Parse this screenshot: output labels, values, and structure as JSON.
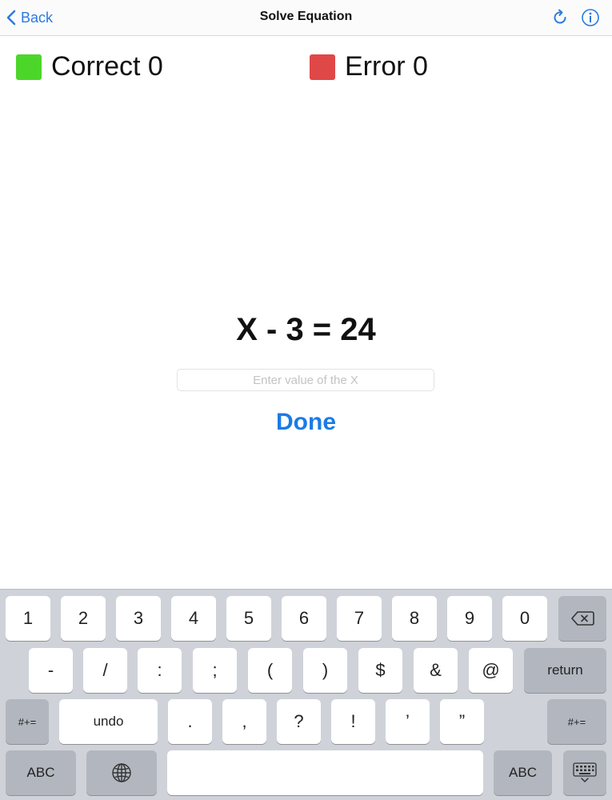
{
  "navbar": {
    "back_label": "Back",
    "title": "Solve Equation",
    "icons": {
      "back": "chevron-left-icon",
      "refresh": "refresh-icon",
      "info": "info-icon"
    }
  },
  "scores": {
    "correct": {
      "label": "Correct 0",
      "color": "#4cd629"
    },
    "error": {
      "label": "Error 0",
      "color": "#e04747"
    }
  },
  "equation": {
    "text": "X - 3 = 24",
    "input_placeholder": "Enter value of the X",
    "input_value": "",
    "done_label": "Done"
  },
  "keyboard": {
    "row1": [
      "1",
      "2",
      "3",
      "4",
      "5",
      "6",
      "7",
      "8",
      "9",
      "0"
    ],
    "row2": [
      "-",
      "/",
      ":",
      ";",
      "(",
      ")",
      "$",
      "&",
      "@"
    ],
    "row3": [
      ".",
      ",",
      "?",
      "!",
      "’",
      "”"
    ],
    "return_label": "return",
    "shift_label": "#+=",
    "undo_label": "undo",
    "abc_label": "ABC",
    "icons": {
      "delete": "delete-icon",
      "globe": "globe-icon",
      "dismiss": "keyboard-dismiss-icon"
    }
  }
}
